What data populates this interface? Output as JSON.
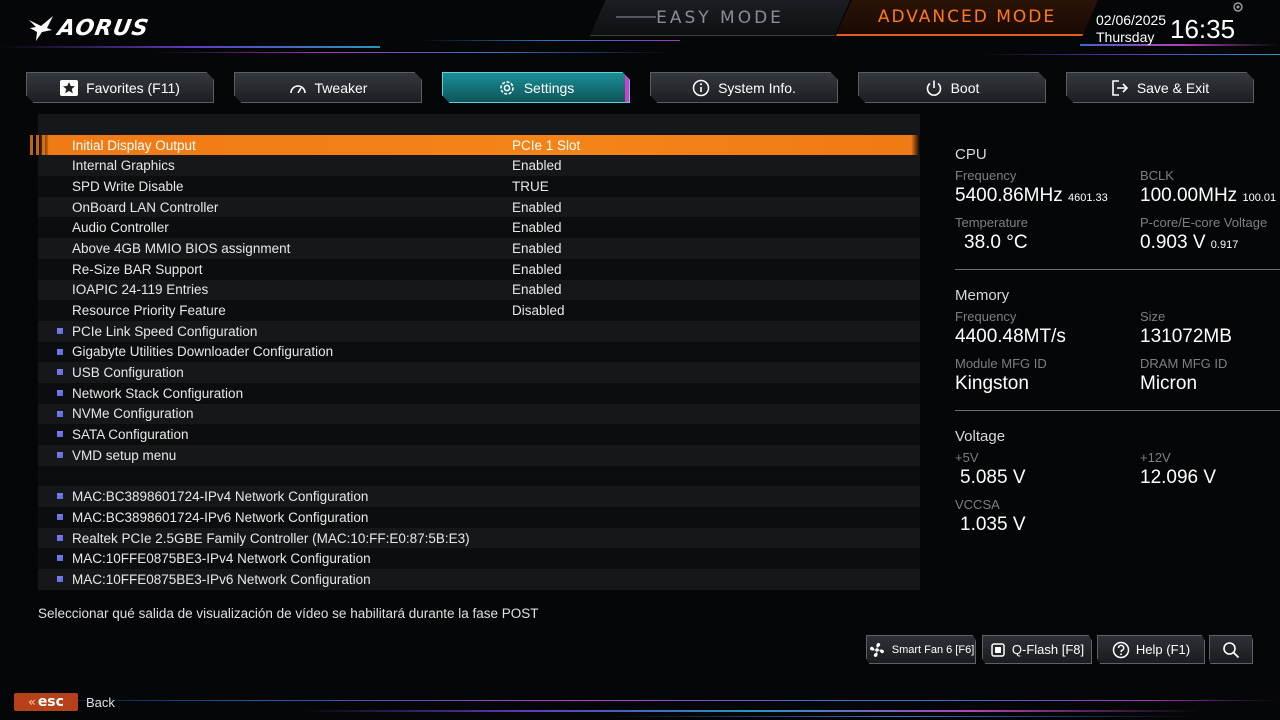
{
  "header": {
    "brand": "AORUS",
    "mode_easy": "EASY MODE",
    "mode_advanced": "ADVANCED MODE",
    "date": "02/06/2025",
    "day": "Thursday",
    "time": "16:35"
  },
  "tabs": [
    {
      "label": "Favorites (F11)",
      "icon": "star-icon"
    },
    {
      "label": "Tweaker",
      "icon": "gauge-icon"
    },
    {
      "label": "Settings",
      "icon": "gear-icon",
      "active": true
    },
    {
      "label": "System Info.",
      "icon": "info-icon"
    },
    {
      "label": "Boot",
      "icon": "power-icon"
    },
    {
      "label": "Save & Exit",
      "icon": "exit-icon"
    }
  ],
  "settings": {
    "rows": [
      {
        "name": "",
        "value": ""
      },
      {
        "name": "Initial Display Output",
        "value": "PCIe 1 Slot"
      },
      {
        "name": "Internal Graphics",
        "value": "Enabled"
      },
      {
        "name": "SPD Write Disable",
        "value": "TRUE"
      },
      {
        "name": "OnBoard LAN Controller",
        "value": "Enabled"
      },
      {
        "name": "Audio Controller",
        "value": "Enabled"
      },
      {
        "name": "Above 4GB MMIO BIOS assignment",
        "value": "Enabled"
      },
      {
        "name": "Re-Size BAR Support",
        "value": "Enabled"
      },
      {
        "name": "IOAPIC 24-119 Entries",
        "value": "Enabled"
      },
      {
        "name": "Resource Priority Feature",
        "value": "Disabled"
      },
      {
        "name": "PCIe Link Speed Configuration",
        "value": ""
      },
      {
        "name": "Gigabyte Utilities Downloader Configuration",
        "value": ""
      },
      {
        "name": "USB Configuration",
        "value": ""
      },
      {
        "name": "Network Stack Configuration",
        "value": ""
      },
      {
        "name": "NVMe Configuration",
        "value": ""
      },
      {
        "name": "SATA Configuration",
        "value": ""
      },
      {
        "name": "VMD setup menu",
        "value": ""
      },
      {
        "name": "",
        "value": ""
      },
      {
        "name": "MAC:BC3898601724-IPv4 Network Configuration",
        "value": ""
      },
      {
        "name": "MAC:BC3898601724-IPv6 Network Configuration",
        "value": ""
      },
      {
        "name": "Realtek PCIe 2.5GBE Family Controller (MAC:10:FF:E0:87:5B:E3)",
        "value": ""
      },
      {
        "name": "MAC:10FFE0875BE3-IPv4 Network Configuration",
        "value": ""
      },
      {
        "name": "MAC:10FFE0875BE3-IPv6 Network Configuration",
        "value": ""
      }
    ],
    "help_text": "Seleccionar qué salida de visualización de vídeo se habilitará durante la fase POST"
  },
  "cpu": {
    "title": "CPU",
    "freq_label": "Frequency",
    "freq_value": "5400.86MHz",
    "freq_sub": "4601.33",
    "bclk_label": "BCLK",
    "bclk_value": "100.00MHz",
    "bclk_sub": "100.01",
    "temp_label": "Temperature",
    "temp_value": "38.0 °C",
    "volt_label": "P-core/E-core Voltage",
    "volt_value": "0.903 V",
    "volt_sub": "0.917"
  },
  "memory": {
    "title": "Memory",
    "freq_label": "Frequency",
    "freq_value": "4400.48MT/s",
    "size_label": "Size",
    "size_value": "131072MB",
    "module_label": "Module MFG ID",
    "module_value": "Kingston",
    "dram_label": "DRAM MFG ID",
    "dram_value": "Micron"
  },
  "voltage": {
    "title": "Voltage",
    "v5_label": "+5V",
    "v5_value": "5.085 V",
    "v12_label": "+12V",
    "v12_value": "12.096 V",
    "vccsa_label": "VCCSA",
    "vccsa_value": "1.035 V"
  },
  "footer": {
    "smartfan": "Smart Fan 6 [F6]",
    "qflash": "Q-Flash [F8]",
    "help": "Help (F1)",
    "esc_key": "esc",
    "back": "Back"
  },
  "colors": {
    "accent_orange": "#f58418",
    "tab_active": "#1a8f97",
    "tab_active_edge": "#d23ec9"
  }
}
